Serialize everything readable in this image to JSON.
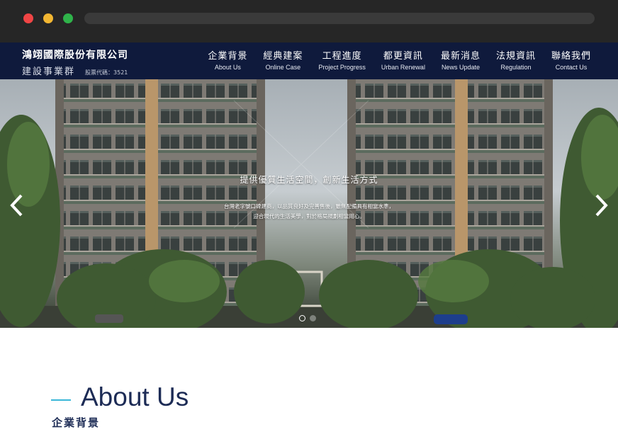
{
  "browser": {
    "window_controls": [
      "close",
      "minimize",
      "maximize"
    ]
  },
  "header": {
    "company_name": "鴻翊國際股份有限公司",
    "division": "建設事業群",
    "stock_code": "股票代碼：3521",
    "nav": [
      {
        "zh": "企業背景",
        "en": "About Us"
      },
      {
        "zh": "經典建案",
        "en": "Online Case"
      },
      {
        "zh": "工程進度",
        "en": "Project Progress"
      },
      {
        "zh": "都更資訊",
        "en": "Urban Renewal"
      },
      {
        "zh": "最新消息",
        "en": "News Update"
      },
      {
        "zh": "法規資訊",
        "en": "Regulation"
      },
      {
        "zh": "聯絡我們",
        "en": "Contact Us"
      }
    ]
  },
  "hero": {
    "title": "提供優質生活空間，創新生活方式",
    "description": "台灣老字號口碑建商，以品質良好及完善售後，雖無配備具有相當水準，迎合現代的生活美學，對於格局規劃相當用心。",
    "prev_icon": "chevron-left-icon",
    "next_icon": "chevron-right-icon",
    "slide_count": 2,
    "active_slide": 1
  },
  "about": {
    "title": "About Us",
    "subtitle": "企業背景"
  },
  "colors": {
    "header_bg": "#0f1a3c",
    "accent_line": "#3ab7d8",
    "heading": "#1c2b55"
  }
}
